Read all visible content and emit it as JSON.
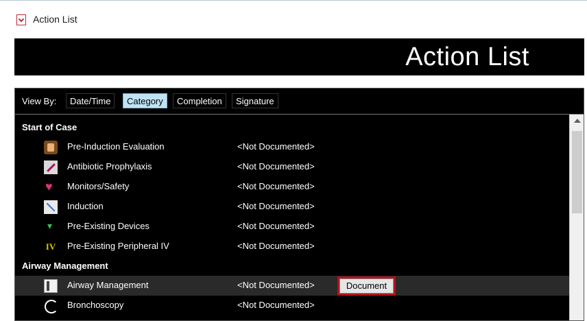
{
  "window": {
    "title": "Action List",
    "icon": "clipboard-check-icon"
  },
  "banner": {
    "title": "Action List"
  },
  "viewby": {
    "label": "View By:",
    "options": [
      "Date/Time",
      "Category",
      "Completion",
      "Signature"
    ],
    "selected": "Category"
  },
  "sections": [
    {
      "title": "Start of Case",
      "items": [
        {
          "label": "Pre-Induction Evaluation",
          "status": "<Not Documented>",
          "icon": "evaluation-icon"
        },
        {
          "label": "Antibiotic Prophylaxis",
          "status": "<Not Documented>",
          "icon": "syringe-icon"
        },
        {
          "label": "Monitors/Safety",
          "status": "<Not Documented>",
          "icon": "heart-monitor-icon"
        },
        {
          "label": "Induction",
          "status": "<Not Documented>",
          "icon": "induction-icon"
        },
        {
          "label": "Pre-Existing Devices",
          "status": "<Not Documented>",
          "icon": "device-icon"
        },
        {
          "label": "Pre-Existing Peripheral IV",
          "status": "<Not Documented>",
          "icon": "iv-icon",
          "icon_text": "IV"
        }
      ]
    },
    {
      "title": "Airway Management",
      "items": [
        {
          "label": "Airway Management",
          "status": "<Not Documented>",
          "icon": "airway-icon",
          "action": "Document"
        },
        {
          "label": "Bronchoscopy",
          "status": "<Not Documented>",
          "icon": "bronchoscopy-icon"
        }
      ]
    }
  ],
  "colors": {
    "highlight_border": "#b3121c",
    "selected_tab": "#bfe3f4",
    "panel_bg": "#000000"
  }
}
